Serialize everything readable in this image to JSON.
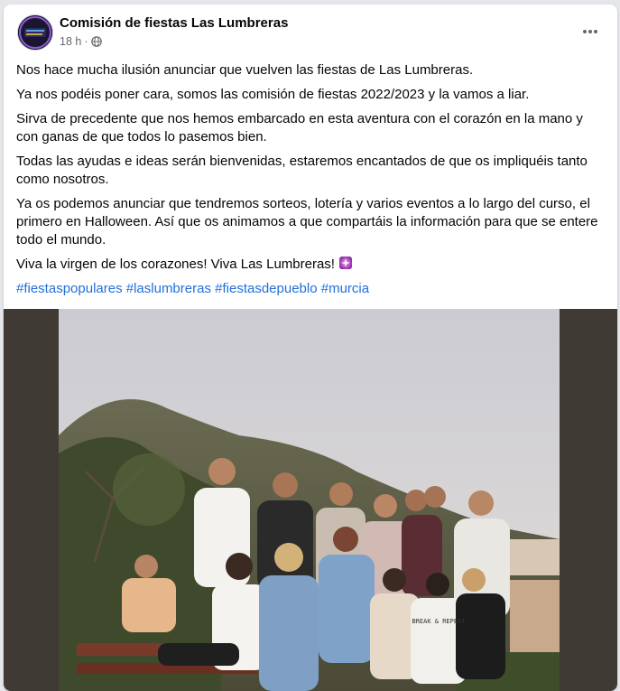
{
  "post": {
    "page_name": "Comisión de fiestas Las Lumbreras",
    "time": "18 h",
    "separator": "·",
    "audience_icon": "globe-icon",
    "more_icon": "more-dots-icon",
    "avatar_logo_text": "Fiestas Las Lumbreras",
    "paragraphs": [
      "Nos hace mucha ilusión anunciar que vuelven las fiestas de Las Lumbreras.",
      "Ya nos podéis poner cara, somos las comisión de fiestas 2022/2023 y la vamos a liar.",
      "Sirva de precedente que nos hemos embarcado en esta aventura con el corazón en la mano y con ganas de que todos lo pasemos bien.",
      "Todas las ayudas e ideas serán bienvenidas, estaremos encantados de que os impliquéis tanto como nosotros.",
      "Ya os podemos anunciar que tendremos sorteos, lotería y varios eventos a lo largo del curso, el primero en Halloween. Así que os animamos a que compartáis la información para que se entere todo el mundo."
    ],
    "closing": "Viva la virgen de los corazones! Viva Las Lumbreras!",
    "closing_emoji": "sparkle-emoji-icon",
    "hashtags": [
      "#fiestaspopulares",
      "#laslumbreras",
      "#fiestasdepueblo",
      "#murcia"
    ],
    "photo_shirt_text": "BREAK & REPEAT"
  },
  "colors": {
    "link": "#216fdb",
    "secondary_text": "#65676b",
    "photo_frame": "#403a35"
  }
}
